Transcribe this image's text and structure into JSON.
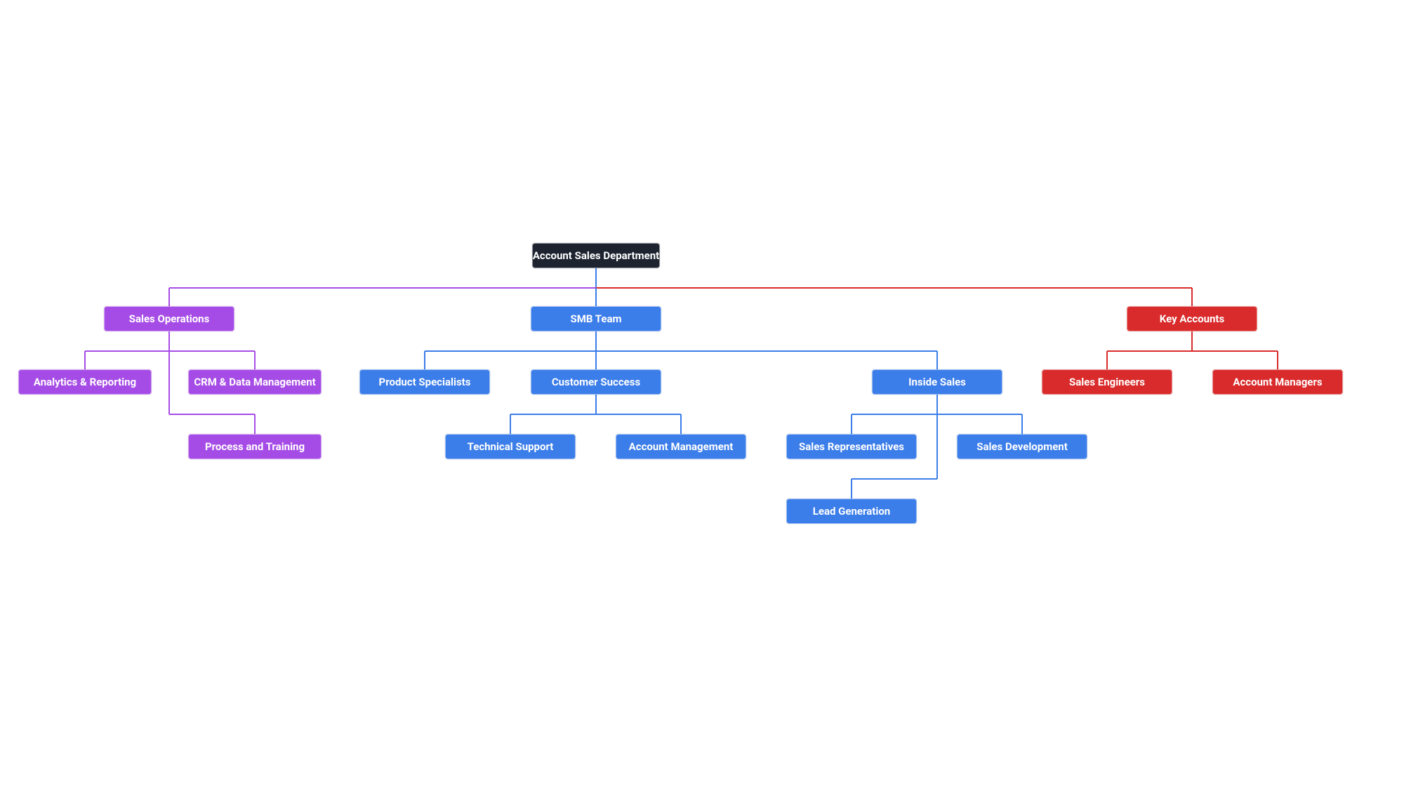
{
  "colors": {
    "root": "#1d2430",
    "purple": "#a64ce6",
    "blue": "#3b7de9",
    "red": "#d92b2b"
  },
  "nodes": {
    "root": "Account Sales Department",
    "salesOperations": "Sales Operations",
    "analyticsReporting": "Analytics & Reporting",
    "crmData": "CRM & Data Management",
    "processTraining": "Process and Training",
    "smbTeam": "SMB Team",
    "productSpecialists": "Product Specialists",
    "customerSuccess": "Customer Success",
    "technicalSupport": "Technical Support",
    "accountManagement": "Account Management",
    "insideSales": "Inside Sales",
    "salesReps": "Sales Representatives",
    "salesDev": "Sales Development",
    "leadGen": "Lead Generation",
    "keyAccounts": "Key Accounts",
    "salesEngineers": "Sales Engineers",
    "accountManagers": "Account Managers"
  }
}
